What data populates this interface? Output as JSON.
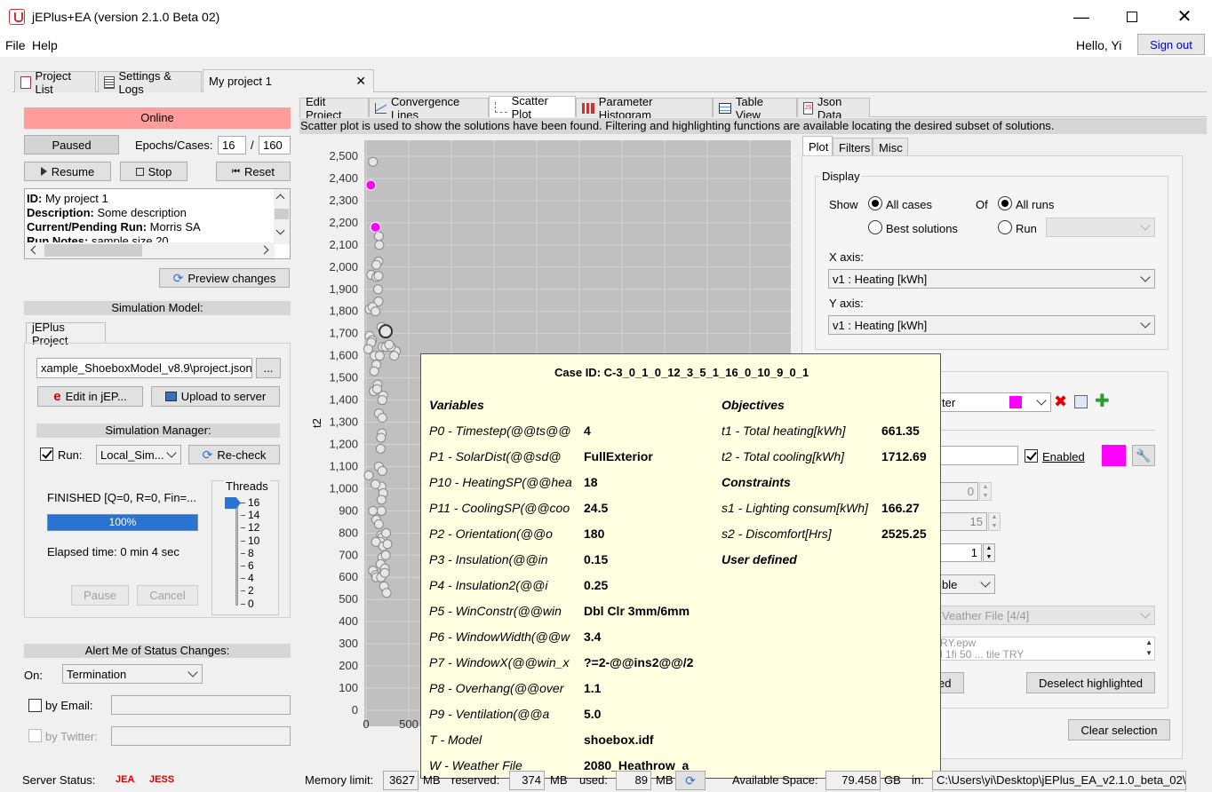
{
  "window": {
    "title": "jEPlus+EA (version 2.1.0 Beta 02)"
  },
  "menu": {
    "items": [
      "File",
      "Help"
    ],
    "greeting": "Hello, Yi",
    "signout": "Sign out"
  },
  "main_tabs": {
    "project_list": "Project List",
    "settings": "Settings & Logs",
    "project": "My project 1"
  },
  "left": {
    "status": "Online",
    "paused": "Paused",
    "epochs_label": "Epochs/Cases:",
    "epochs_value": "16",
    "epochs_sep": "/",
    "epochs_total": "160",
    "resume": "Resume",
    "stop": "Stop",
    "reset": "Reset",
    "info": [
      {
        "k": "ID",
        "v": " My project 1"
      },
      {
        "k": "Description",
        "v": " Some description"
      },
      {
        "k": "Current/Pending Run",
        "v": " Morris SA"
      },
      {
        "k": "Run Notes",
        "v": " sample size 20"
      }
    ],
    "preview": "Preview changes",
    "sim_model_hdr": "Simulation Model:",
    "jeplus_tab": "jEPlus Project",
    "project_path": "xample_ShoeboxModel_v8.9\\project.json",
    "browse": "...",
    "edit_in": "Edit in jEP...",
    "upload": "Upload to server",
    "sim_manager_hdr": "Simulation Manager:",
    "run_label": "Run:",
    "run_combo": "Local_Sim...",
    "recheck": "Re-check",
    "finished": "FINISHED [Q=0, R=0, Fin=...",
    "progress": 1.0,
    "progress_text": "100%",
    "elapsed": "Elapsed time: 0 min 4 sec",
    "threads_label": "Threads",
    "threads_ticks": [
      "16",
      "14",
      "12",
      "10",
      "8",
      "6",
      "4",
      "2",
      "0"
    ],
    "threads_value": 16,
    "pause_btn": "Pause",
    "cancel_btn": "Cancel",
    "alert_hdr": "Alert Me of Status Changes:",
    "on_label": "On:",
    "on_value": "Termination",
    "by_email": "by Email:",
    "by_twitter": "by Twitter:"
  },
  "sub_tabs": [
    "Edit Project",
    "Convergence Lines",
    "Scatter Plot",
    "Parameter Histogram",
    "Table View",
    "Json Data"
  ],
  "info_bar": "Scatter plot is used to show the solutions have been found. Filtering and highlighting functions are available locating the desired subset of solutions.",
  "chart_data": {
    "type": "scatter",
    "ylabel": "t2",
    "xlabel": "",
    "y_ticks": [
      "2,500",
      "2,400",
      "2,300",
      "2,200",
      "2,100",
      "2,000",
      "1,900",
      "1,800",
      "1,700",
      "1,600",
      "1,500",
      "1,400",
      "1,300",
      "1,200",
      "1,100",
      "1,000",
      "900",
      "800",
      "700",
      "600",
      "500",
      "400",
      "300",
      "200",
      "100",
      "0"
    ],
    "x_ticks": [
      "0",
      "500"
    ],
    "ylim": [
      0,
      2600
    ],
    "xlim": [
      0,
      1900
    ],
    "grid": true,
    "highlighted_color": "#ff00ff",
    "highlighted": [
      {
        "x": 55,
        "y": 2370
      },
      {
        "x": 110,
        "y": 2180
      }
    ],
    "points": [
      {
        "x": 80,
        "y": 2475
      },
      {
        "x": 150,
        "y": 2140
      },
      {
        "x": 155,
        "y": 2100
      },
      {
        "x": 145,
        "y": 2025
      },
      {
        "x": 120,
        "y": 2010
      },
      {
        "x": 60,
        "y": 1965
      },
      {
        "x": 120,
        "y": 1955
      },
      {
        "x": 145,
        "y": 1960
      },
      {
        "x": 140,
        "y": 1900
      },
      {
        "x": 145,
        "y": 1845
      },
      {
        "x": 40,
        "y": 1810
      },
      {
        "x": 75,
        "y": 1820
      },
      {
        "x": 110,
        "y": 1800
      },
      {
        "x": 180,
        "y": 1730
      },
      {
        "x": 40,
        "y": 1690
      },
      {
        "x": 70,
        "y": 1670
      },
      {
        "x": 60,
        "y": 1660
      },
      {
        "x": 25,
        "y": 1630
      },
      {
        "x": 195,
        "y": 1640
      },
      {
        "x": 230,
        "y": 1640
      },
      {
        "x": 100,
        "y": 1600
      },
      {
        "x": 160,
        "y": 1600
      },
      {
        "x": 120,
        "y": 1560
      },
      {
        "x": 95,
        "y": 1530
      },
      {
        "x": 135,
        "y": 1470
      },
      {
        "x": 90,
        "y": 1440
      },
      {
        "x": 130,
        "y": 1450
      },
      {
        "x": 200,
        "y": 1420
      },
      {
        "x": 190,
        "y": 1400
      },
      {
        "x": 150,
        "y": 1340
      },
      {
        "x": 190,
        "y": 1320
      },
      {
        "x": 185,
        "y": 1250
      },
      {
        "x": 175,
        "y": 1230
      },
      {
        "x": 170,
        "y": 1180
      },
      {
        "x": 150,
        "y": 1100
      },
      {
        "x": 30,
        "y": 1060
      },
      {
        "x": 190,
        "y": 1080
      },
      {
        "x": 180,
        "y": 1010
      },
      {
        "x": 110,
        "y": 1020
      },
      {
        "x": 200,
        "y": 980
      },
      {
        "x": 180,
        "y": 950
      },
      {
        "x": 80,
        "y": 900
      },
      {
        "x": 180,
        "y": 900
      },
      {
        "x": 120,
        "y": 860
      },
      {
        "x": 150,
        "y": 840
      },
      {
        "x": 175,
        "y": 790
      },
      {
        "x": 190,
        "y": 780
      },
      {
        "x": 170,
        "y": 760
      },
      {
        "x": 115,
        "y": 760
      },
      {
        "x": 200,
        "y": 740
      },
      {
        "x": 190,
        "y": 690
      },
      {
        "x": 170,
        "y": 660
      },
      {
        "x": 80,
        "y": 630
      },
      {
        "x": 110,
        "y": 610
      },
      {
        "x": 120,
        "y": 600
      },
      {
        "x": 175,
        "y": 600
      },
      {
        "x": 220,
        "y": 640
      },
      {
        "x": 230,
        "y": 700
      },
      {
        "x": 250,
        "y": 750
      },
      {
        "x": 235,
        "y": 800
      },
      {
        "x": 210,
        "y": 560
      },
      {
        "x": 240,
        "y": 530
      },
      {
        "x": 220,
        "y": 620
      },
      {
        "x": 350,
        "y": 1620
      },
      {
        "x": 330,
        "y": 1600
      },
      {
        "x": 290,
        "y": 1640
      },
      {
        "x": 270,
        "y": 1650
      }
    ],
    "selected_point": {
      "x": 230,
      "y": 1710
    }
  },
  "right": {
    "tabs": [
      "Plot",
      "Filters",
      "Misc"
    ],
    "display_legend": "Display",
    "show_label": "Show",
    "all_cases": "All cases",
    "best_solutions": "Best solutions",
    "of_label": "Of",
    "all_runs": "All runs",
    "run": "Run",
    "x_axis_label": "X axis:",
    "x_axis_value": "v1 : Heating [kWh]",
    "y_axis_label": "Y axis:",
    "y_axis_value": "v1 : Heating [kWh]",
    "filter_suffix": "ter",
    "enabled": "Enabled",
    "spin1": "0",
    "spin2": "15",
    "spin3": "1",
    "ble": "ble",
    "weather": "Veather File [4/4]",
    "epw": "RY.epw",
    "epw2": "l 1fi 50 ... tile TRY",
    "selected_partial": "ed",
    "deselect": "Deselect highlighted",
    "clear": "Clear selection",
    "accent": "#ff00ff"
  },
  "tooltip": {
    "case_id": "Case ID: C-3_0_1_0_12_3_5_1_16_0_10_9_0_1",
    "variables_hdr": "Variables",
    "objectives_hdr": "Objectives",
    "constraints_hdr": "Constraints",
    "user_defined_hdr": "User defined",
    "variables": [
      {
        "k": "P0 - Timestep(@@ts@@",
        "v": "4"
      },
      {
        "k": "P1 - SolarDist(@@sd@",
        "v": "FullExterior"
      },
      {
        "k": "P10 - HeatingSP(@@hea",
        "v": "18"
      },
      {
        "k": "P11 - CoolingSP(@@coo",
        "v": "24.5"
      },
      {
        "k": "P2 - Orientation(@@o",
        "v": "180"
      },
      {
        "k": "P3 - Insulation(@@in",
        "v": "0.15"
      },
      {
        "k": "P4 - Insulation2(@@i",
        "v": "0.25"
      },
      {
        "k": "P5 - WinConstr(@@win",
        "v": "Dbl Clr 3mm/6mm"
      },
      {
        "k": "P6 - WindowWidth(@@w",
        "v": "3.4"
      },
      {
        "k": "P7 - WindowX(@@win_x",
        "v": "?=2-@@ins2@@/2"
      },
      {
        "k": "P8 - Overhang(@@over",
        "v": "1.1"
      },
      {
        "k": "P9 - Ventilation(@@a",
        "v": "5.0"
      },
      {
        "k": "T - Model",
        "v": "shoebox.idf"
      },
      {
        "k": "W - Weather File",
        "v": "2080_Heathrow_a"
      }
    ],
    "objectives": [
      {
        "k": "t1 - Total heating[kWh]",
        "v": "661.35"
      },
      {
        "k": "t2 - Total cooling[kWh]",
        "v": "1712.69"
      }
    ],
    "constraints": [
      {
        "k": "s1 - Lighting consum[kWh]",
        "v": "166.27"
      },
      {
        "k": "s2 - Discomfort[Hrs]",
        "v": "2525.25"
      }
    ]
  },
  "footer": {
    "server_status": "Server Status:",
    "jea": "JEA",
    "jess": "JESS",
    "mem_limit_label": "Memory limit:",
    "mem_limit": "3627",
    "mb1": "MB",
    "reserved_label": "reserved:",
    "reserved": "374",
    "mb2": "MB",
    "used_label": "used:",
    "used": "89",
    "mb3": "MB",
    "avail_label": "Available Space:",
    "avail": "79.458",
    "gb": "GB",
    "in_label": "in:",
    "path": "C:\\Users\\yi\\Desktop\\jEPlus_EA_v2.1.0_beta_02\\."
  }
}
